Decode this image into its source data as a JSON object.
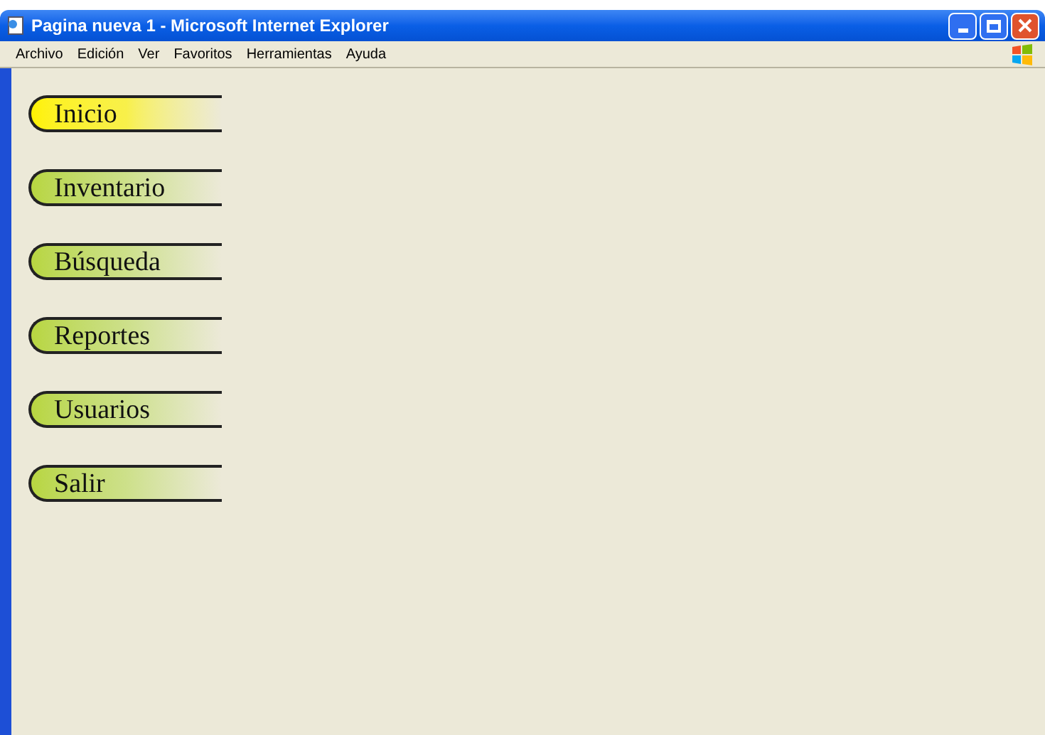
{
  "window": {
    "title": "Pagina nueva 1 - Microsoft Internet Explorer"
  },
  "menu": [
    "Archivo",
    "Edición",
    "Ver",
    "Favoritos",
    "Herramientas",
    "Ayuda"
  ],
  "nav": [
    {
      "label": "Inicio",
      "selected": true
    },
    {
      "label": "Inventario",
      "selected": false
    },
    {
      "label": "Búsqueda",
      "selected": false
    },
    {
      "label": "Reportes",
      "selected": false
    },
    {
      "label": "Usuarios",
      "selected": false
    },
    {
      "label": "Salir",
      "selected": false
    }
  ]
}
